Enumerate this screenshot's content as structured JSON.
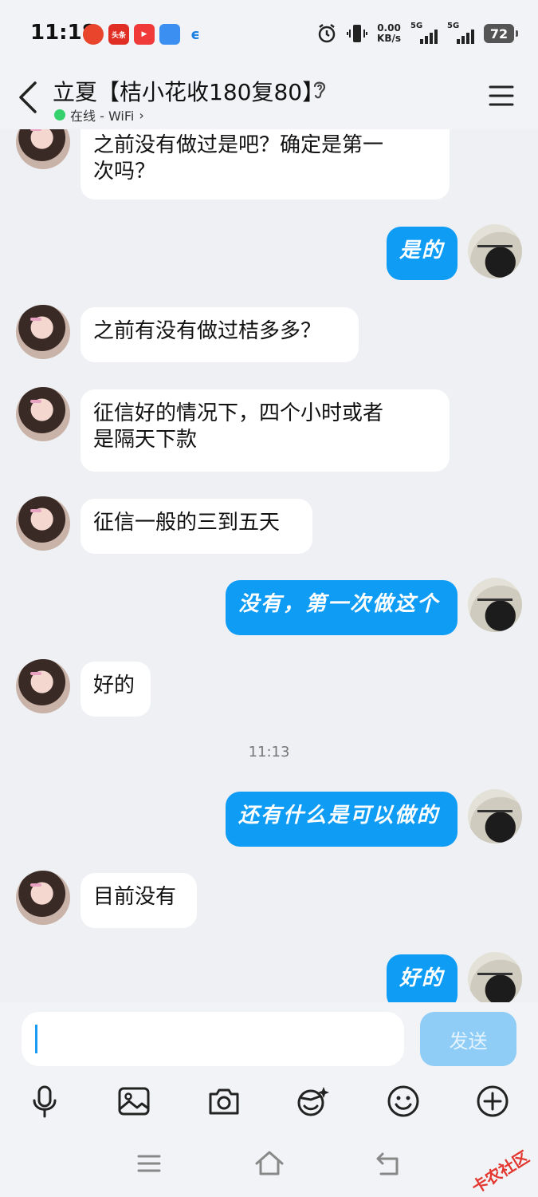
{
  "status_bar": {
    "time": "11:18",
    "net_speed_value": "0.00",
    "net_speed_unit": "KB/s",
    "sim1_label": "5G",
    "sim2_label": "5G",
    "battery_level": "72",
    "notification_icons": [
      "app-icon-red",
      "toutiao-icon",
      "video-app-icon",
      "blue-app-icon",
      "telecom-icon"
    ],
    "toutiao_text": "头条"
  },
  "header": {
    "title": "立夏【桔小花收180复80】",
    "status_text": "在线 - WiFi",
    "status_color": "#35d16c"
  },
  "messages": [
    {
      "side": "in",
      "text_lines": [
        "之前没有做过是吧？确定是第一",
        "次吗？"
      ]
    },
    {
      "side": "out",
      "text_lines": [
        "是的"
      ]
    },
    {
      "side": "in",
      "text_lines": [
        "之前有没有做过桔多多？"
      ]
    },
    {
      "side": "in",
      "text_lines": [
        "征信好的情况下，四个小时或者",
        "是隔天下款"
      ]
    },
    {
      "side": "in",
      "text_lines": [
        "征信一般的三到五天"
      ]
    },
    {
      "side": "out",
      "text_lines": [
        "没有，第一次做这个"
      ]
    },
    {
      "side": "in",
      "text_lines": [
        "好的"
      ]
    },
    {
      "side": "time",
      "text": "11:13"
    },
    {
      "side": "out",
      "text_lines": [
        "还有什么是可以做的"
      ]
    },
    {
      "side": "in",
      "text_lines": [
        "目前没有"
      ]
    },
    {
      "side": "out",
      "text_lines": [
        "好的"
      ]
    }
  ],
  "input": {
    "value": "",
    "send_label": "发送"
  },
  "toolbar": {
    "icons": [
      "microphone-icon",
      "image-icon",
      "camera-icon",
      "sticker-icon",
      "emoji-icon",
      "plus-icon"
    ]
  },
  "watermark": {
    "text": "卡农社区"
  },
  "colors": {
    "outgoing_bubble": "#0f9cf5",
    "incoming_bubble": "#ffffff",
    "send_button_disabled": "#8fcdf7",
    "background": "#eef0f3"
  }
}
